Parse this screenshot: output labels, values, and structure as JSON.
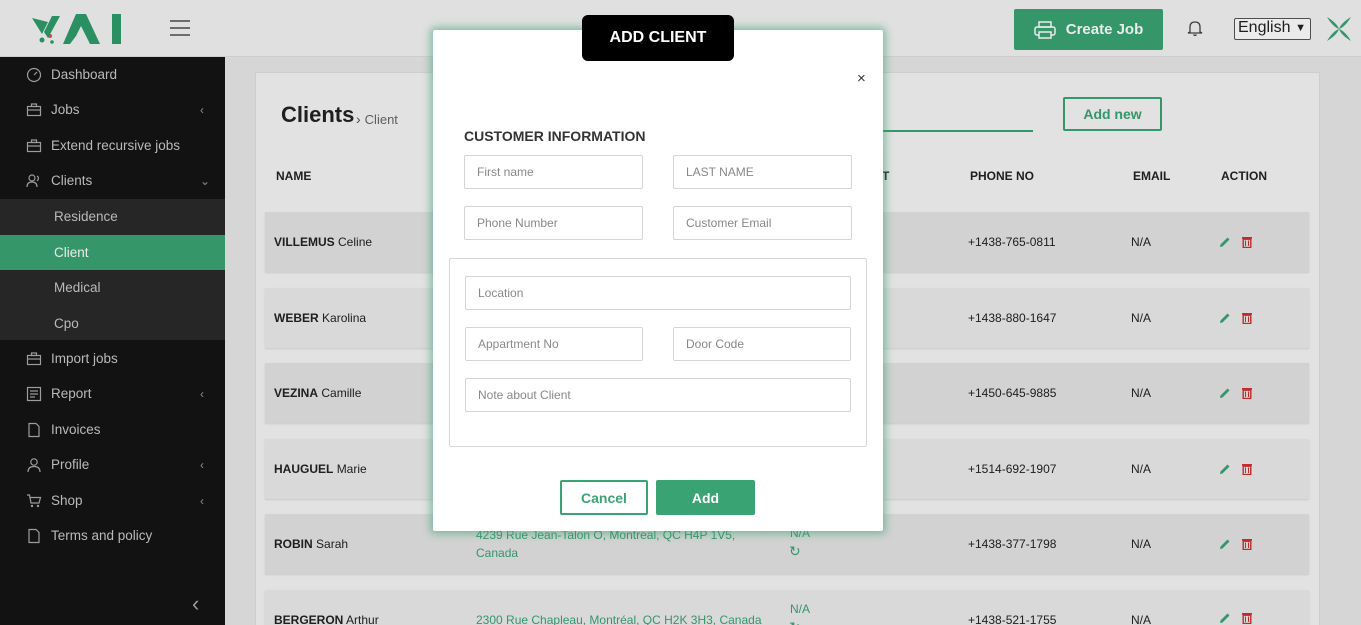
{
  "header": {
    "create_job_label": "Create Job",
    "language_selected": "English",
    "icons": [
      "printer-icon",
      "bell-icon",
      "chevron-down-icon"
    ]
  },
  "sidebar": {
    "items": [
      {
        "label": "Dashboard",
        "icon": "gauge-icon"
      },
      {
        "label": "Jobs",
        "icon": "briefcase-icon"
      },
      {
        "label": "Extend recursive jobs",
        "icon": "briefcase-icon"
      },
      {
        "label": "Clients",
        "icon": "users-icon"
      },
      {
        "label": "Import jobs",
        "icon": "briefcase-icon"
      },
      {
        "label": "Report",
        "icon": "report-icon"
      },
      {
        "label": "Invoices",
        "icon": "document-icon"
      },
      {
        "label": "Profile",
        "icon": "user-icon"
      },
      {
        "label": "Shop",
        "icon": "cart-icon"
      },
      {
        "label": "Terms and policy",
        "icon": "document-icon"
      }
    ],
    "client_sub": [
      "Residence",
      "Client",
      "Medical",
      "Cpo"
    ]
  },
  "page": {
    "title": "Clients",
    "breadcrumb": "Client",
    "add_new_label": "Add new",
    "columns": {
      "name": "NAME",
      "t_partial": "T",
      "phone": "PHONE NO",
      "email": "EMAIL",
      "action": "ACTION"
    }
  },
  "rows": [
    {
      "last": "VILLEMUS",
      "first": "Celine",
      "phone": "+1438-765-0811",
      "email": "N/A"
    },
    {
      "last": "WEBER",
      "first": "Karolina",
      "phone": "+1438-880-1647",
      "email": "N/A"
    },
    {
      "last": "VEZINA",
      "first": "Camille",
      "phone": "+1450-645-9885",
      "email": "N/A"
    },
    {
      "last": "HAUGUEL",
      "first": "Marie",
      "phone": "+1514-692-1907",
      "email": "N/A"
    },
    {
      "last": "ROBIN",
      "first": "Sarah",
      "address": "4239 Rue Jean-Talon O, Montreal, QC H4P 1V5, Canada",
      "status": "N/A",
      "phone": "+1438-377-1798",
      "email": "N/A"
    },
    {
      "last": "BERGERON",
      "first": "Arthur",
      "address": "2300 Rue Chapleau, Montréal, QC H2K 3H3, Canada",
      "status": "N/A",
      "phone": "+1438-521-1755",
      "email": "N/A"
    }
  ],
  "modal": {
    "title": "ADD CLIENT",
    "close": "×",
    "section": "CUSTOMER INFORMATION",
    "placeholders": {
      "first_name": "First name",
      "last_name": "LAST NAME",
      "phone": "Phone Number",
      "email": "Customer Email",
      "location": "Location",
      "apartment": "Appartment No",
      "door_code": "Door Code",
      "note": "Note about Client"
    },
    "cancel_label": "Cancel",
    "add_label": "Add"
  },
  "colors": {
    "accent": "#3aa373",
    "sidebar_bg": "#141414",
    "delete": "#d32f2f"
  }
}
